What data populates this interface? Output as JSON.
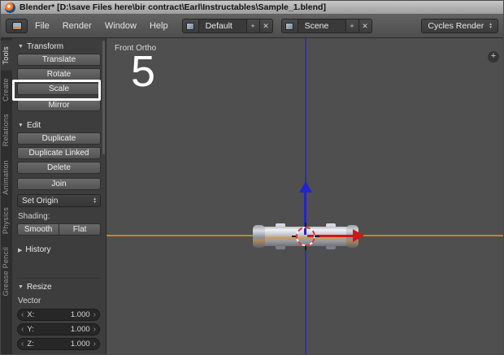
{
  "window": {
    "title": "Blender* [D:\\save Files here\\bir contract\\Earl\\Instructables\\Sample_1.blend]"
  },
  "icons": {
    "collapse": "▼",
    "collapsed": "▶",
    "plus": "+",
    "close": "✕",
    "left_arrow": "‹",
    "right_arrow": "›",
    "dropdown_up": "▴",
    "dropdown_down": "▾"
  },
  "menubar": {
    "menus": [
      {
        "label": "File"
      },
      {
        "label": "Render"
      },
      {
        "label": "Window"
      },
      {
        "label": "Help"
      }
    ],
    "layout_selector": {
      "value": "Default"
    },
    "scene_selector": {
      "value": "Scene"
    },
    "engine_selector": {
      "value": "Cycles Render"
    }
  },
  "toolshelf": {
    "tabs": [
      {
        "label": "Tools"
      },
      {
        "label": "Create"
      },
      {
        "label": "Relations"
      },
      {
        "label": "Animation"
      },
      {
        "label": "Physics"
      },
      {
        "label": "Grease Pencil"
      }
    ],
    "transform": {
      "title": "Transform",
      "buttons": [
        {
          "label": "Translate"
        },
        {
          "label": "Rotate"
        },
        {
          "label": "Scale"
        },
        {
          "label": "Mirror"
        }
      ]
    },
    "edit": {
      "title": "Edit",
      "buttons": [
        {
          "label": "Duplicate"
        },
        {
          "label": "Duplicate Linked"
        },
        {
          "label": "Delete"
        }
      ],
      "join": "Join",
      "set_origin": "Set Origin",
      "shading_label": "Shading:",
      "smooth": "Smooth",
      "flat": "Flat"
    },
    "history": {
      "title": "History"
    },
    "resize": {
      "title": "Resize",
      "vector_label": "Vector",
      "fields": [
        {
          "label": "X:",
          "value": "1.000"
        },
        {
          "label": "Y:",
          "value": "1.000"
        },
        {
          "label": "Z:",
          "value": "1.000"
        }
      ]
    }
  },
  "viewport": {
    "view_label": "Front Ortho",
    "annotation": "5"
  }
}
